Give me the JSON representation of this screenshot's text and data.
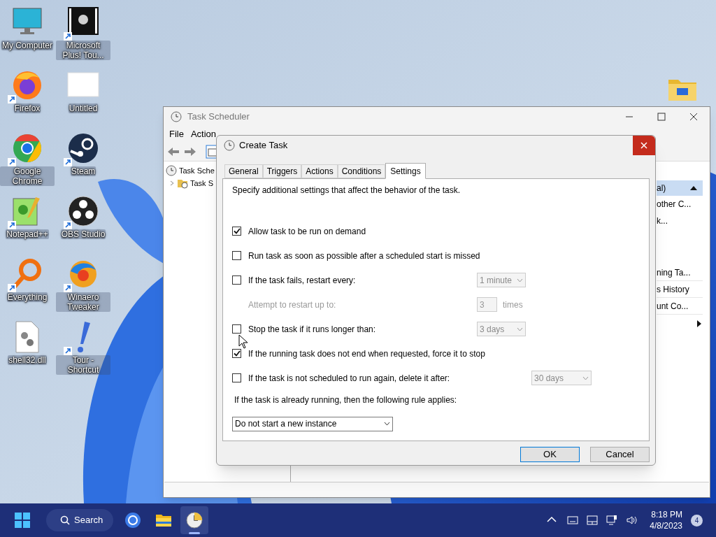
{
  "desktop_icons": [
    {
      "label": "My Computer",
      "kind": "monitor",
      "shortcut": false
    },
    {
      "label": "Microsoft Plus! Tou...",
      "kind": "film",
      "shortcut": true
    },
    {
      "label": "Firefox",
      "kind": "firefox",
      "shortcut": true
    },
    {
      "label": "Untitled",
      "kind": "blank",
      "shortcut": false
    },
    {
      "label": "Google Chrome",
      "kind": "chrome",
      "shortcut": true
    },
    {
      "label": "Steam",
      "kind": "steam",
      "shortcut": true
    },
    {
      "label": "Notepad++",
      "kind": "notepad",
      "shortcut": true
    },
    {
      "label": "OBS Studio",
      "kind": "obs",
      "shortcut": true
    },
    {
      "label": "Everything",
      "kind": "everything",
      "shortcut": true
    },
    {
      "label": "Winaero Tweaker",
      "kind": "winaero",
      "shortcut": true
    },
    {
      "label": "shell32.dll",
      "kind": "dll",
      "shortcut": false
    },
    {
      "label": "Tour - Shortcut",
      "kind": "tour",
      "shortcut": true
    }
  ],
  "background_window": {
    "title": "Task Scheduler",
    "menu": [
      "File",
      "Action"
    ],
    "tree": [
      {
        "label": "Task Sche",
        "children": [
          {
            "label": "Task S",
            "expanded": false
          }
        ]
      }
    ],
    "actions_header": "al)",
    "actions_top": [
      "other C...",
      "k..."
    ],
    "actions_bottom": [
      "ning Ta...",
      "s History",
      "unt Co..."
    ]
  },
  "dialog": {
    "title": "Create Task",
    "tabs": [
      {
        "label": "General",
        "selected": false
      },
      {
        "label": "Triggers",
        "selected": false
      },
      {
        "label": "Actions",
        "selected": false
      },
      {
        "label": "Conditions",
        "selected": false
      },
      {
        "label": "Settings",
        "selected": true
      }
    ],
    "intro": "Specify additional settings that affect the behavior of the task.",
    "rows": [
      {
        "kind": "checkbox",
        "label": "Allow task to be run on demand",
        "checked": true,
        "hovered": false
      },
      {
        "kind": "checkbox",
        "label": "Run task as soon as possible after a scheduled start is missed",
        "checked": false,
        "hovered": false
      },
      {
        "kind": "checkbox",
        "label": "If the task fails, restart every:",
        "checked": false,
        "hovered": false,
        "dropdown": {
          "value": "1 minute",
          "disabled": true
        }
      },
      {
        "kind": "spin",
        "label": "Attempt to restart up to:",
        "value": "3",
        "unit": "times",
        "disabled": true
      },
      {
        "kind": "checkbox",
        "label": "Stop the task if it runs longer than:",
        "checked": false,
        "hovered": true,
        "dropdown": {
          "value": "3 days",
          "disabled": true
        }
      },
      {
        "kind": "checkbox",
        "label": "If the running task does not end when requested, force it to stop",
        "checked": true,
        "hovered": false
      },
      {
        "kind": "checkbox",
        "label": "If the task is not scheduled to run again, delete it after:",
        "checked": false,
        "hovered": false,
        "dropdown": {
          "value": "30 days",
          "disabled": true
        }
      },
      {
        "kind": "text",
        "label": "If the task is already running, then the following rule applies:"
      },
      {
        "kind": "select",
        "value": "Do not start a new instance",
        "disabled": false
      }
    ],
    "buttons": [
      {
        "label": "OK",
        "default": true
      },
      {
        "label": "Cancel",
        "default": false
      }
    ]
  },
  "taskbar": {
    "search": "Search",
    "apps": [
      {
        "kind": "browser",
        "active": false
      },
      {
        "kind": "folder",
        "active": false
      },
      {
        "kind": "clock",
        "active": true
      }
    ],
    "time": "8:18 PM",
    "date": "4/8/2023",
    "notifications": "4"
  }
}
